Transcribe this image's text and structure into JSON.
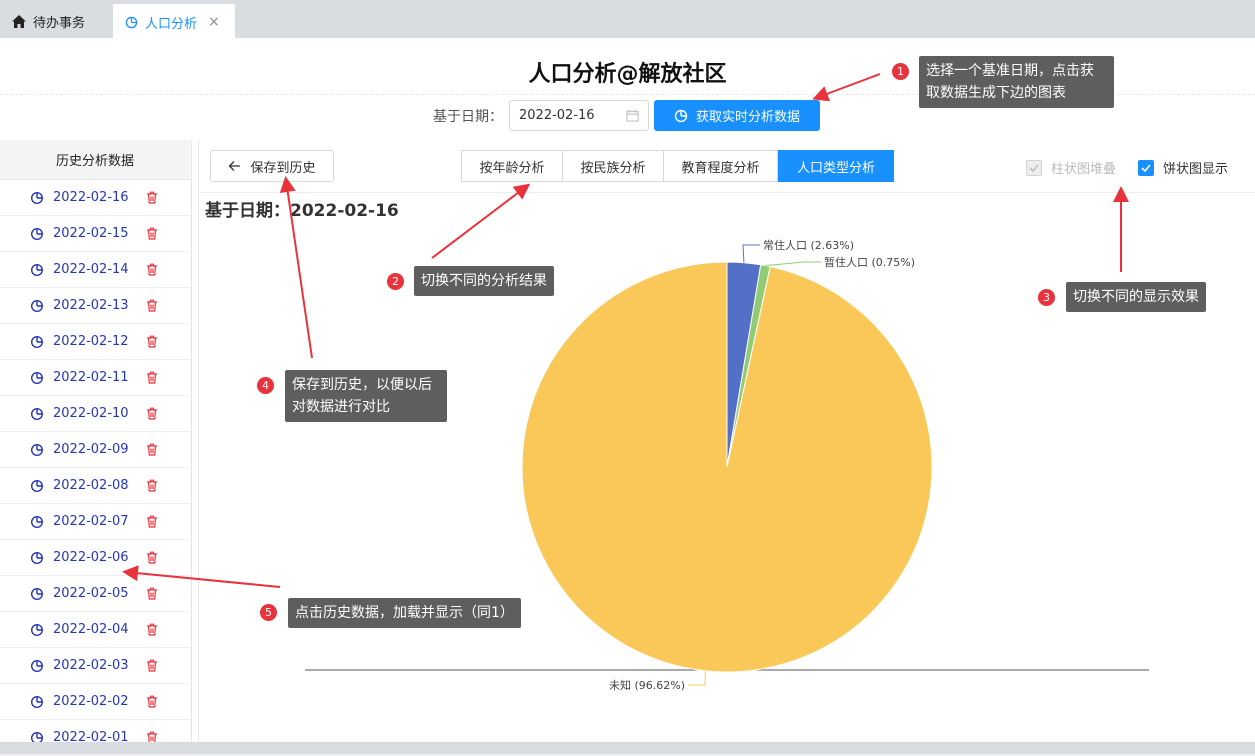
{
  "tabs": [
    {
      "label": "待办事务",
      "icon": "home-icon"
    },
    {
      "label": "人口分析",
      "icon": "pie-chart-icon",
      "close": "×"
    }
  ],
  "page_title": "人口分析@解放社区",
  "date_label": "基于日期：",
  "date_value": "2022-02-16",
  "fetch_button": "获取实时分析数据",
  "sidebar": {
    "header": "历史分析数据",
    "items": [
      "2022-02-16",
      "2022-02-15",
      "2022-02-14",
      "2022-02-13",
      "2022-02-12",
      "2022-02-11",
      "2022-02-10",
      "2022-02-09",
      "2022-02-08",
      "2022-02-07",
      "2022-02-06",
      "2022-02-05",
      "2022-02-04",
      "2022-02-03",
      "2022-02-02",
      "2022-02-01"
    ]
  },
  "save_button": "保存到历史",
  "analysis_tabs": [
    "按年龄分析",
    "按民族分析",
    "教育程度分析",
    "人口类型分析"
  ],
  "active_tab": 3,
  "options": {
    "stack_label": "柱状图堆叠",
    "pie_label": "饼状图显示",
    "stack_checked": true,
    "stack_disabled": true,
    "pie_checked": true
  },
  "chart_date_label": "基于日期：2022-02-16",
  "chart_data": {
    "type": "pie",
    "slices": [
      {
        "label": "常住人口",
        "value": 2.63,
        "display": "常住人口 (2.63%)",
        "color": "#5470c6"
      },
      {
        "label": "暂住人口",
        "value": 0.75,
        "display": "暂住人口 (0.75%)",
        "color": "#91cc75"
      },
      {
        "label": "未知",
        "value": 96.62,
        "display": "未知 (96.62%)",
        "color": "#fac858"
      }
    ]
  },
  "callouts": [
    {
      "num": "1",
      "text": "选择一个基准日期，点击获取数据生成下边的图表"
    },
    {
      "num": "2",
      "text": "切换不同的分析结果"
    },
    {
      "num": "3",
      "text": "切换不同的显示效果"
    },
    {
      "num": "4",
      "text": "保存到历史，以便以后对数据进行对比"
    },
    {
      "num": "5",
      "text": "点击历史数据，加载并显示（同1）"
    }
  ],
  "colors": {
    "accent": "#1890ff",
    "link": "#2634b8",
    "danger": "#e8323c",
    "callout_bg": "#5e5e5e"
  }
}
